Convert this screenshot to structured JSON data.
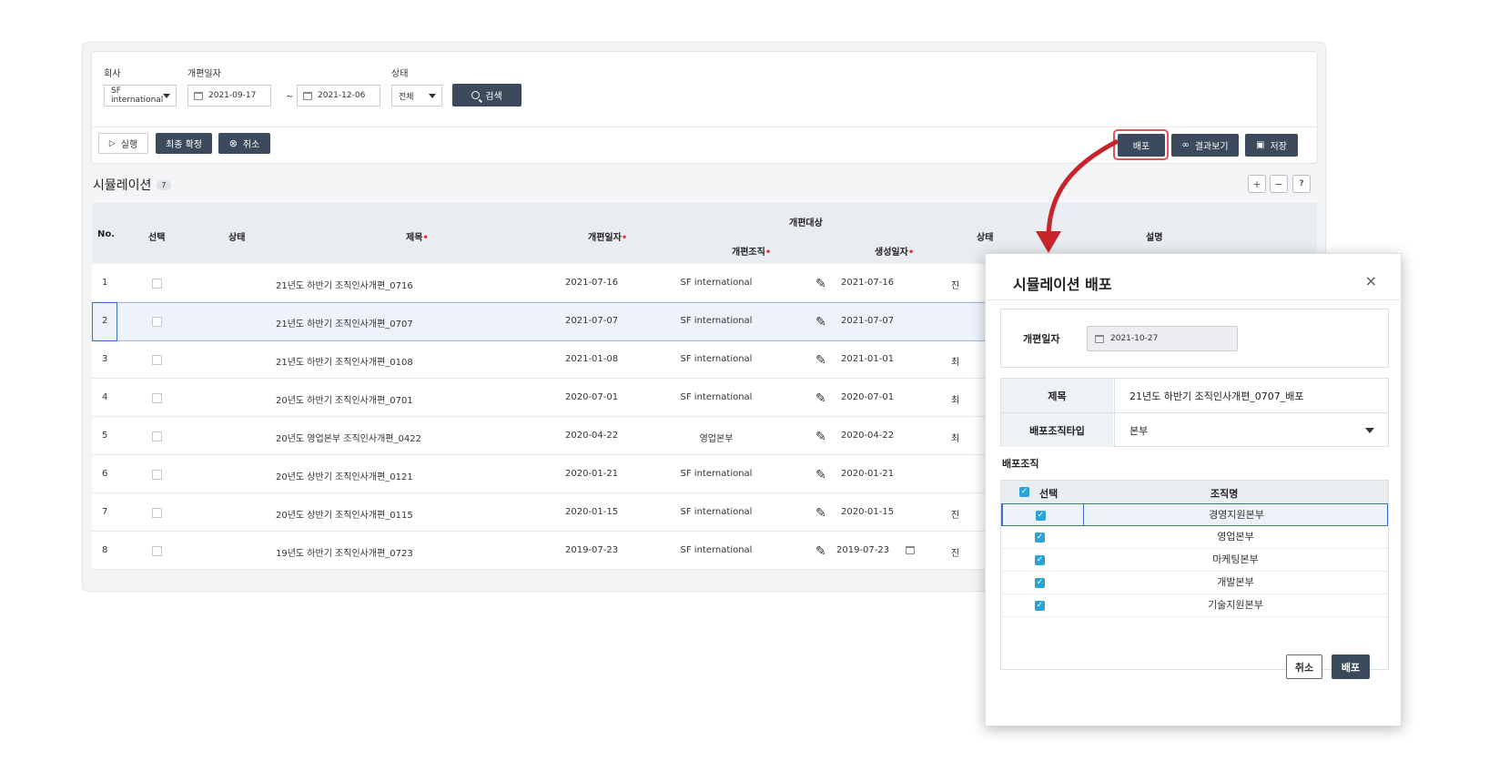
{
  "filters": {
    "company_label": "회사",
    "company_value": "SF international",
    "date_label": "개편일자",
    "date_from": "2021-09-17",
    "date_sep": "~",
    "date_to": "2021-12-06",
    "status_label": "상태",
    "status_value": "전체",
    "search_label": "검색"
  },
  "toolbar": {
    "run": "실행",
    "final_confirm": "최종 확정",
    "cancel": "취소",
    "deploy": "배포",
    "view_result": "결과보기",
    "save": "저장"
  },
  "section": {
    "title": "시뮬레이션",
    "count": "7"
  },
  "table": {
    "headers": {
      "no": "No.",
      "select": "선택",
      "status": "상태",
      "title": "제목",
      "date": "개편일자",
      "target": "개편대상",
      "org": "개편조직",
      "created": "생성일자",
      "status2": "상태",
      "desc": "설명"
    },
    "rows": [
      {
        "no": "1",
        "title": "21년도 하반기 조직인사개편_0716",
        "date": "2021-07-16",
        "org": "SF international",
        "created": "2021-07-16",
        "st": "진"
      },
      {
        "no": "2",
        "title": "21년도 하반기 조직인사개편_0707",
        "date": "2021-07-07",
        "org": "SF international",
        "created": "2021-07-07",
        "st": ""
      },
      {
        "no": "3",
        "title": "21년도 하반기 조직인사개편_0108",
        "date": "2021-01-08",
        "org": "SF international",
        "created": "2021-01-01",
        "st": "최"
      },
      {
        "no": "4",
        "title": "20년도 하반기 조직인사개편_0701",
        "date": "2020-07-01",
        "org": "SF international",
        "created": "2020-07-01",
        "st": "최"
      },
      {
        "no": "5",
        "title": "20년도 영업본부 조직인사개편_0422",
        "date": "2020-04-22",
        "org": "영업본부",
        "created": "2020-04-22",
        "st": "최"
      },
      {
        "no": "6",
        "title": "20년도 상반기 조직인사개편_0121",
        "date": "2020-01-21",
        "org": "SF international",
        "created": "2020-01-21",
        "st": ""
      },
      {
        "no": "7",
        "title": "20년도 상반기 조직인사개편_0115",
        "date": "2020-01-15",
        "org": "SF international",
        "created": "2020-01-15",
        "st": "진"
      },
      {
        "no": "8",
        "title": "19년도 하반기 조직인사개편_0723",
        "date": "2019-07-23",
        "org": "SF international",
        "created": "2019-07-23",
        "st": "진"
      }
    ]
  },
  "modal": {
    "title": "시뮬레이션 배포",
    "close": "×",
    "date_label": "개편일자",
    "date_value": "2021-10-27",
    "subject_label": "제목",
    "subject_value": "21년도 하반기 조직인사개편_0707_배포",
    "org_type_label": "배포조직타입",
    "org_type_value": "본부",
    "org_section": "배포조직",
    "col_select": "선택",
    "col_name": "조직명",
    "orgs": [
      "경영지원본부",
      "영업본부",
      "마케팅본부",
      "개발본부",
      "기술지원본부"
    ],
    "cancel": "취소",
    "deploy": "배포"
  },
  "colors": {
    "dark_button": "#3b4a5c",
    "highlight": "#e0545c",
    "arrow": "#c8242c",
    "check": "#2aa3d6"
  }
}
